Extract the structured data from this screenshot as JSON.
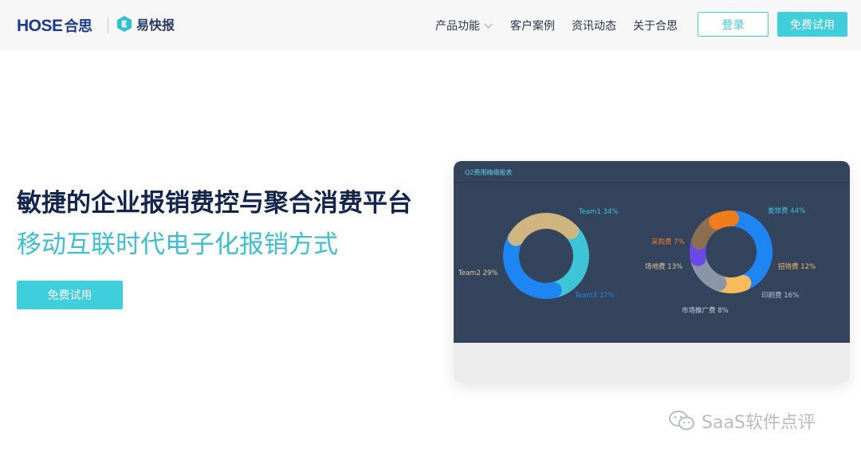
{
  "header": {
    "logo_hose": "HOSE",
    "logo_hose_cn": "合思",
    "logo_product": "易快报",
    "nav": [
      {
        "label": "产品功能",
        "has_dropdown": true
      },
      {
        "label": "客户案例",
        "has_dropdown": false
      },
      {
        "label": "资讯动态",
        "has_dropdown": false
      },
      {
        "label": "关于合思",
        "has_dropdown": false
      }
    ],
    "login_label": "登录",
    "trial_label": "免费试用"
  },
  "hero": {
    "title": "敏捷的企业报销费控与聚合消费平台",
    "subtitle": "移动互联时代电子化报销方式",
    "cta_label": "免费试用"
  },
  "dashboard": {
    "title": "Q2费用精细报表"
  },
  "chart_data": [
    {
      "type": "pie",
      "variant": "donut",
      "labels": [
        "Team1",
        "Team3",
        "Team2"
      ],
      "values": [
        34,
        37,
        29
      ],
      "value_labels": [
        "34%",
        "37%",
        "29%"
      ],
      "colors": [
        "#3dc4d6",
        "#1e86f2",
        "#cfb580"
      ]
    },
    {
      "type": "pie",
      "variant": "donut",
      "labels": [
        "差旅费",
        "招待费",
        "印刷费",
        "市场推广费",
        "场地费",
        "采购费"
      ],
      "values": [
        44,
        12,
        16,
        8,
        13,
        7
      ],
      "value_labels": [
        "44%",
        "12%",
        "16%",
        "8%",
        "13%",
        "7%"
      ],
      "colors": [
        "#1e86f2",
        "#f6bb5a",
        "#8a96a8",
        "#6a49e8",
        "#8a6f50",
        "#f07c1c"
      ],
      "label_colors": [
        "#3dc4d6",
        "#f6bb5a",
        "#b8c0cc",
        "#c9cfd8",
        "#e1c79a",
        "#f07c1c"
      ]
    }
  ],
  "watermark": {
    "text": "SaaS软件点评",
    "icon": "wechat-icon"
  }
}
